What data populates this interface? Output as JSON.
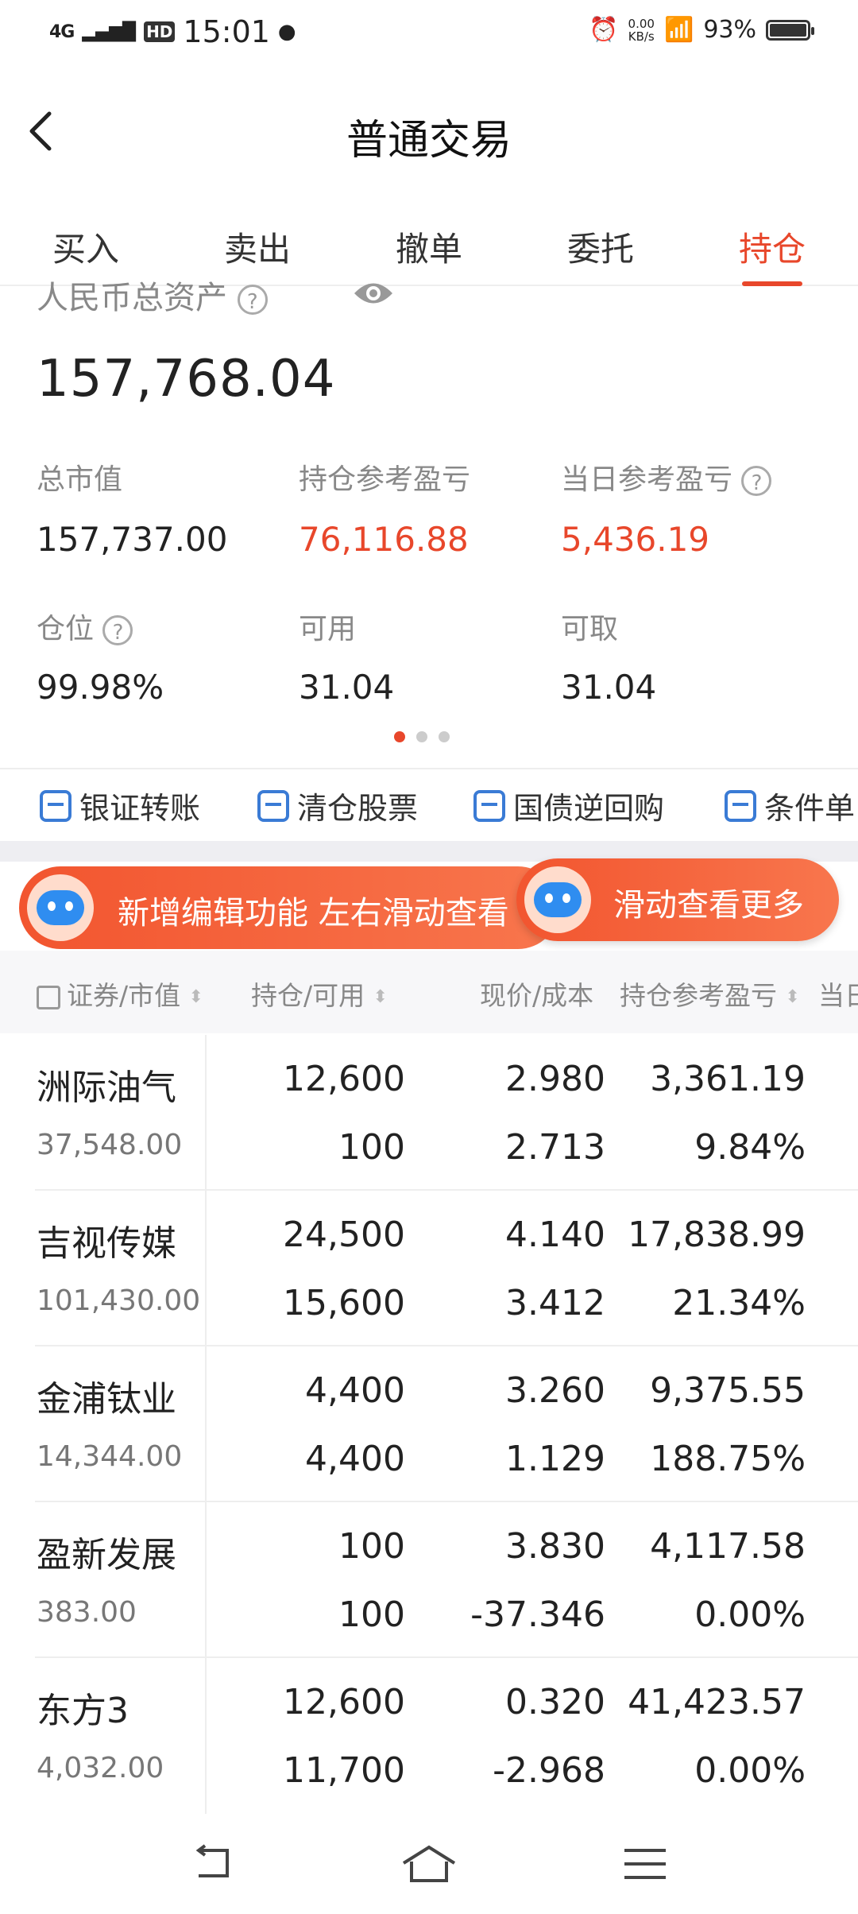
{
  "status": {
    "network": "4G",
    "hd": "HD",
    "time": "15:01",
    "speed_value": "0.00",
    "speed_unit": "KB/s",
    "battery": "93%"
  },
  "header": {
    "title": "普通交易"
  },
  "tabs": [
    {
      "label": "买入",
      "active": false
    },
    {
      "label": "卖出",
      "active": false
    },
    {
      "label": "撤单",
      "active": false
    },
    {
      "label": "委托",
      "active": false
    },
    {
      "label": "持仓",
      "active": true
    }
  ],
  "summary": {
    "total_label": "人民币总资产",
    "total_value": "157,768.04",
    "market_value_label": "总市值",
    "market_value": "157,737.00",
    "position_pl_label": "持仓参考盈亏",
    "position_pl": "76,116.88",
    "daily_pl_label": "当日参考盈亏",
    "daily_pl": "5,436.19",
    "position_ratio_label": "仓位",
    "position_ratio": "99.98%",
    "available_label": "可用",
    "available": "31.04",
    "withdrawable_label": "可取",
    "withdrawable": "31.04"
  },
  "actions": [
    "银证转账",
    "清仓股票",
    "国债逆回购",
    "条件单"
  ],
  "banners": {
    "left": "新增编辑功能 左右滑动查看",
    "right": "滑动查看更多"
  },
  "table": {
    "headers": [
      "证券/市值",
      "持仓/可用",
      "现价/成本",
      "持仓参考盈亏",
      "当日"
    ],
    "rows": [
      {
        "name": "洲际油气",
        "market_value": "37,548.00",
        "holding": "12,600",
        "available": "100",
        "price": "2.980",
        "cost": "2.713",
        "pl": "3,361.19",
        "pl_pct": "9.84%"
      },
      {
        "name": "吉视传媒",
        "market_value": "101,430.00",
        "holding": "24,500",
        "available": "15,600",
        "price": "4.140",
        "cost": "3.412",
        "pl": "17,838.99",
        "pl_pct": "21.34%"
      },
      {
        "name": "金浦钛业",
        "market_value": "14,344.00",
        "holding": "4,400",
        "available": "4,400",
        "price": "3.260",
        "cost": "1.129",
        "pl": "9,375.55",
        "pl_pct": "188.75%"
      },
      {
        "name": "盈新发展",
        "market_value": "383.00",
        "holding": "100",
        "available": "100",
        "price": "3.830",
        "cost": "-37.346",
        "pl": "4,117.58",
        "pl_pct": "0.00%"
      },
      {
        "name": "东方3",
        "market_value": "4,032.00",
        "holding": "12,600",
        "available": "11,700",
        "price": "0.320",
        "cost": "-2.968",
        "pl": "41,423.57",
        "pl_pct": "0.00%"
      }
    ]
  },
  "colors": {
    "accent": "#e8472b",
    "link_icon": "#3a7bd5"
  }
}
